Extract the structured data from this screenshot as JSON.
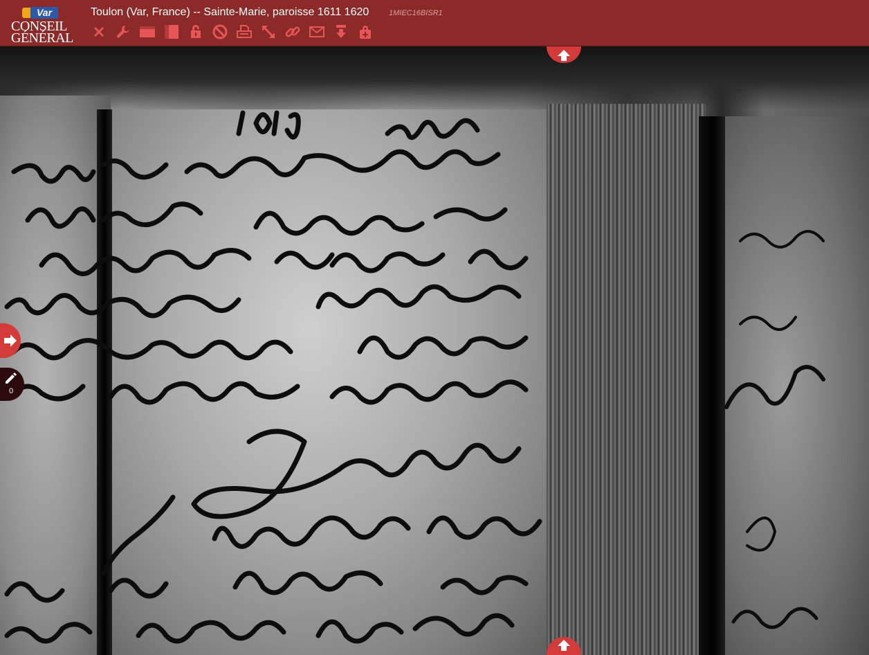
{
  "logo": {
    "badge": "Var",
    "line1": "CONSEIL",
    "line2": "GÉNÉRAL"
  },
  "document": {
    "title": "Toulon (Var, France) -- Sainte-Marie, paroisse 1611 1620",
    "code": "1MIEC16BISR1"
  },
  "toolbar": {
    "tools": [
      {
        "name": "close",
        "icon": "close-icon"
      },
      {
        "name": "settings",
        "icon": "wrench-icon"
      },
      {
        "name": "single-page",
        "icon": "single-page-icon"
      },
      {
        "name": "double-page",
        "icon": "double-page-icon"
      },
      {
        "name": "lock",
        "icon": "lock-icon"
      },
      {
        "name": "block",
        "icon": "ban-icon"
      },
      {
        "name": "print",
        "icon": "printer-icon"
      },
      {
        "name": "fullscreen",
        "icon": "expand-icon"
      },
      {
        "name": "link",
        "icon": "link-icon"
      },
      {
        "name": "email",
        "icon": "envelope-icon"
      },
      {
        "name": "download",
        "icon": "download-icon"
      },
      {
        "name": "add",
        "icon": "add-lock-icon"
      }
    ]
  },
  "notes": {
    "count": "0"
  },
  "colors": {
    "header": "#8c2a2a",
    "accent": "#d33b3b",
    "icon": "#e65656"
  }
}
